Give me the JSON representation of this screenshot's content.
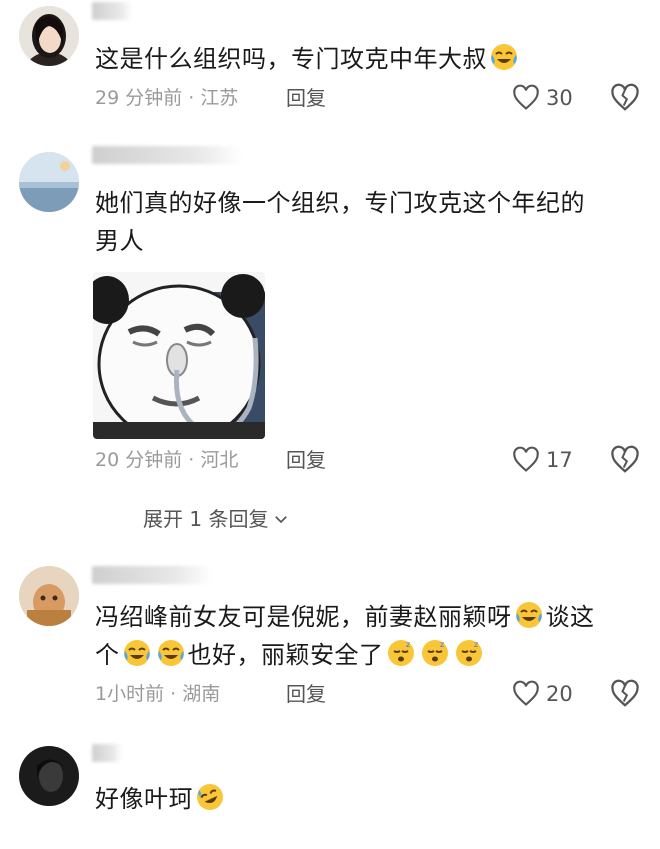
{
  "comments": [
    {
      "text": "这是什么组织吗，专门攻克中年大叔",
      "time": "29 分钟前",
      "location": "江苏",
      "reply": "回复",
      "likes": "30",
      "emoji": "tears-of-joy"
    },
    {
      "text_line1": "她们真的好像一个组织，专门攻克这个年纪的",
      "text_line2": "男人",
      "time": "20 分钟前",
      "location": "河北",
      "reply": "回复",
      "likes": "17",
      "expand": "展开 1 条回复"
    },
    {
      "text_line1": "冯绍峰前女友可是倪妮，前妻赵丽颖呀",
      "text_line1_tail": "谈这",
      "text_line2_a": "个",
      "text_line2_b": "也好，丽颖安全了",
      "time": "1小时前",
      "location": "湖南",
      "reply": "回复",
      "likes": "20"
    },
    {
      "text": "好像叶珂"
    }
  ],
  "colors": {
    "text": "#1a1a1a",
    "meta": "#9a9a9a",
    "action": "#555555",
    "emoji_yellow": "#f8c637"
  }
}
